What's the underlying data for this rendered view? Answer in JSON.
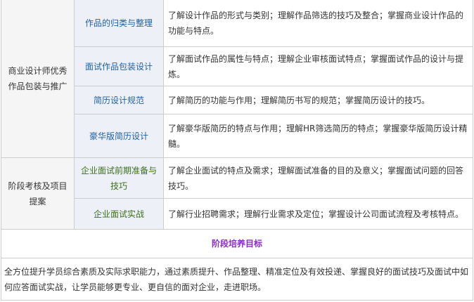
{
  "rows": [
    {
      "group": "商业设计师优秀作品包装与推广",
      "title": "作品的归类与整理",
      "desc": "了解设计作品的形式与类别；理解作品筛选的技巧及整合；掌握商业设计作品的功能与特点。"
    },
    {
      "title": "面试作品包装设计",
      "desc": "了解面试作品的属性与特点；理解企业审核面试特点；掌握面试作品的设计与提炼。"
    },
    {
      "title": "简历设计规范",
      "desc": "了解简历的功能与作用；理解简历书写的规范；掌握简历设计的技巧。"
    },
    {
      "title": "豪华版简历设计",
      "desc": "了解豪华版简历的特点与作用；理解HR筛选简历的特点；掌握豪华版简历设计精髓。"
    },
    {
      "group": "阶段考核及项目提案",
      "title": "企业面试前期准备与技巧",
      "desc": "了解企业面试的特点及需求；理解面试准备的目的及意义；掌握面试问题的回答技巧。"
    },
    {
      "title": "企业面试实战",
      "desc": "了解行业招聘需求；理解行业需求及定位；掌握设计公司面试流程及考核特点。"
    }
  ],
  "section_title": "阶段培养目标",
  "summary": "全方位提升学员综合素质及实际求职能力，通过素质提升、作品整理、精准定位及有效投递、掌握良好的面试技巧及面试中如何应答面试实战，让学员能够更专业、更自信的面对企业，走进职场。"
}
